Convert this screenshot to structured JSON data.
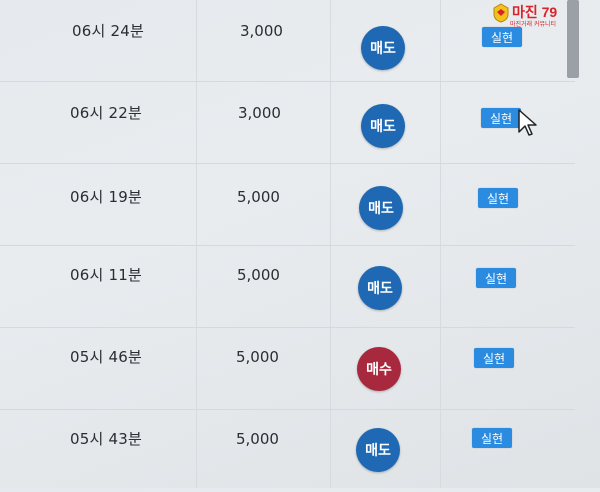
{
  "trades": [
    {
      "time": "06시 24분",
      "qty": "3,000",
      "side": "매도",
      "side_type": "sell",
      "action": "실현"
    },
    {
      "time": "06시 22분",
      "qty": "3,000",
      "side": "매도",
      "side_type": "sell",
      "action": "실현"
    },
    {
      "time": "06시 19분",
      "qty": "5,000",
      "side": "매도",
      "side_type": "sell",
      "action": "실현"
    },
    {
      "time": "06시 11분",
      "qty": "5,000",
      "side": "매도",
      "side_type": "sell",
      "action": "실현"
    },
    {
      "time": "05시 46분",
      "qty": "5,000",
      "side": "매수",
      "side_type": "buy",
      "action": "실현"
    },
    {
      "time": "05시 43분",
      "qty": "5,000",
      "side": "매도",
      "side_type": "sell",
      "action": "실현"
    }
  ],
  "colors": {
    "sell": "#1f69b4",
    "buy": "#a8283e",
    "realize": "#2a8be0",
    "watermark": "#d8232a"
  },
  "watermark": {
    "title": "마진 79",
    "subtitle": "마진거래 커뮤니티"
  }
}
